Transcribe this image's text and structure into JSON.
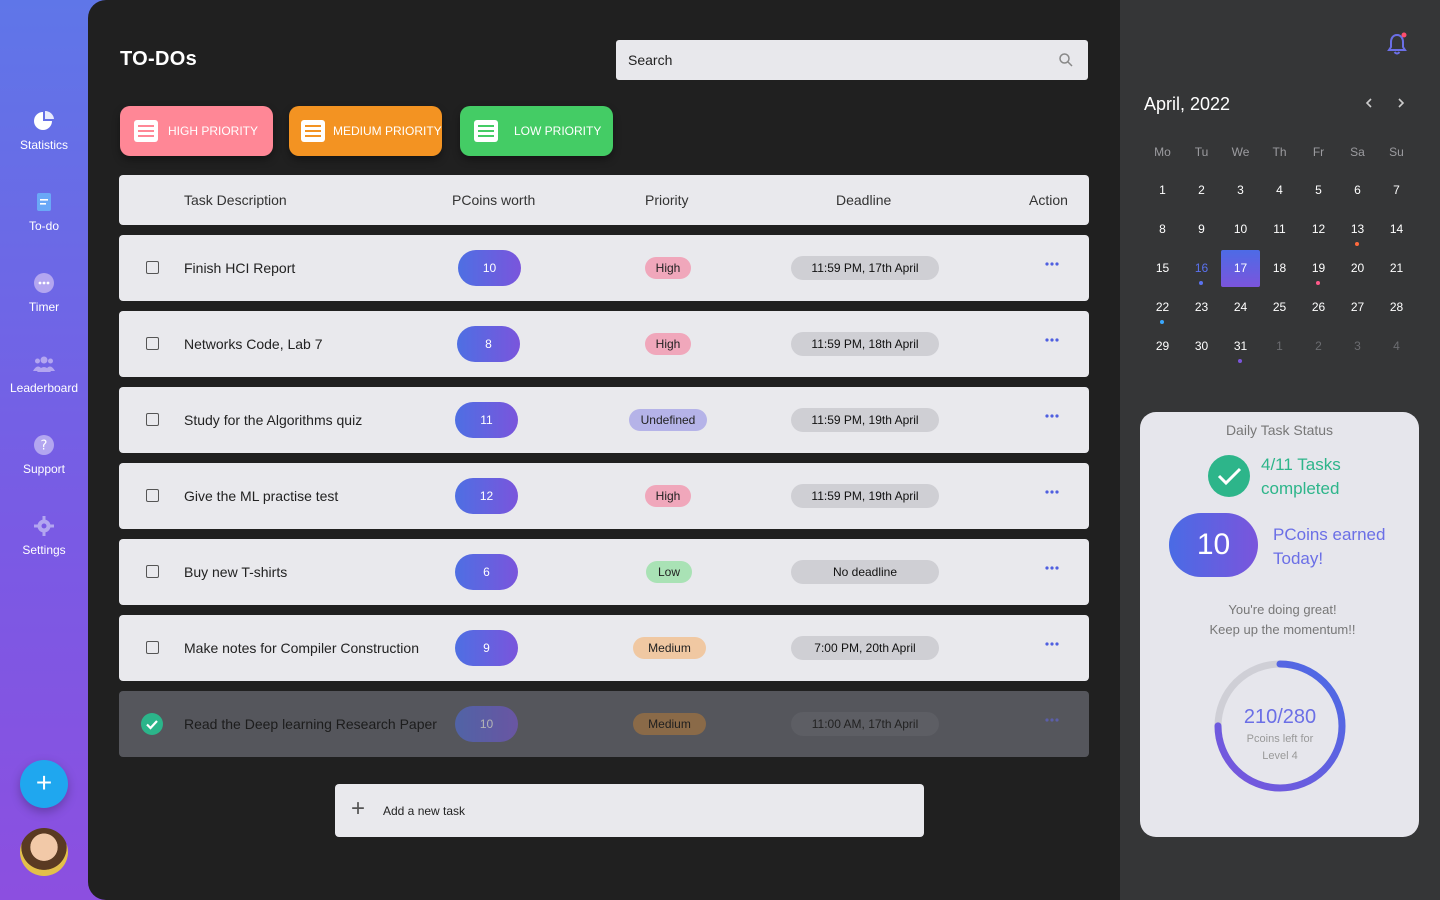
{
  "sidebar": {
    "items": [
      {
        "label": "Statistics",
        "icon": "pie-chart-icon"
      },
      {
        "label": "To-do",
        "icon": "document-icon"
      },
      {
        "label": "Timer",
        "icon": "chat-bubble-icon"
      },
      {
        "label": "Leaderboard",
        "icon": "users-icon"
      },
      {
        "label": "Support",
        "icon": "help-icon"
      },
      {
        "label": "Settings",
        "icon": "gear-icon"
      }
    ],
    "fab_label": "+"
  },
  "header": {
    "title": "TO-DOs",
    "search_placeholder": "Search"
  },
  "priority_buttons": {
    "high": "HIGH PRIORITY",
    "medium": "MEDIUM PRIORITY",
    "low": "LOW PRIORITY"
  },
  "table": {
    "columns": [
      "Task Description",
      "PCoins worth",
      "Priority",
      "Deadline",
      "Action"
    ],
    "rows": [
      {
        "task": "Finish HCI Report",
        "coins": "10",
        "priority": "High",
        "deadline": "11:59 PM, 17th April",
        "done": false
      },
      {
        "task": "Networks Code, Lab 7",
        "coins": "8",
        "priority": "High",
        "deadline": "11:59 PM, 18th April",
        "done": false
      },
      {
        "task": "Study for the Algorithms quiz",
        "coins": "11",
        "priority": "Undefined",
        "deadline": "11:59 PM, 19th April",
        "done": false
      },
      {
        "task": "Give the ML practise test",
        "coins": "12",
        "priority": "High",
        "deadline": "11:59 PM, 19th April",
        "done": false
      },
      {
        "task": "Buy new T-shirts",
        "coins": "6",
        "priority": "Low",
        "deadline": "No deadline",
        "done": false
      },
      {
        "task": "Make notes for Compiler Construction",
        "coins": "9",
        "priority": "Medium",
        "deadline": "7:00 PM, 20th April",
        "done": false
      },
      {
        "task": "Read the Deep learning Research Paper",
        "coins": "10",
        "priority": "Medium",
        "deadline": "11:00 AM, 17th April",
        "done": true
      }
    ]
  },
  "add_task": {
    "label": "Add a new task"
  },
  "calendar": {
    "title": "April, 2022",
    "weekdays": [
      "Mo",
      "Tu",
      "We",
      "Th",
      "Fr",
      "Sa",
      "Su"
    ],
    "weeks": [
      [
        "1",
        "2",
        "3",
        "4",
        "5",
        "6",
        "7"
      ],
      [
        "8",
        "9",
        "10",
        "11",
        "12",
        "13",
        "14"
      ],
      [
        "15",
        "16",
        "17",
        "18",
        "19",
        "20",
        "21"
      ],
      [
        "22",
        "23",
        "24",
        "25",
        "26",
        "27",
        "28"
      ],
      [
        "29",
        "30",
        "31",
        "1",
        "2",
        "3",
        "4"
      ]
    ],
    "selected_day": "17"
  },
  "status": {
    "title": "Daily Task Status",
    "tasks_completed": "4/11 Tasks completed",
    "coins_today": "10",
    "coins_label": "PCoins earned Today!",
    "encourage_line1": "You're doing great!",
    "encourage_line2": "Keep up the momentum!!",
    "progress_value": "210/280",
    "progress_fraction": 0.75,
    "progress_sub_line1": "Pcoins left for",
    "progress_sub_line2": "Level 4"
  },
  "colors": {
    "accent": "#6b6fe6",
    "success": "#2db58a",
    "high": "#ff8796",
    "medium": "#f39322",
    "low": "#44cc65"
  }
}
